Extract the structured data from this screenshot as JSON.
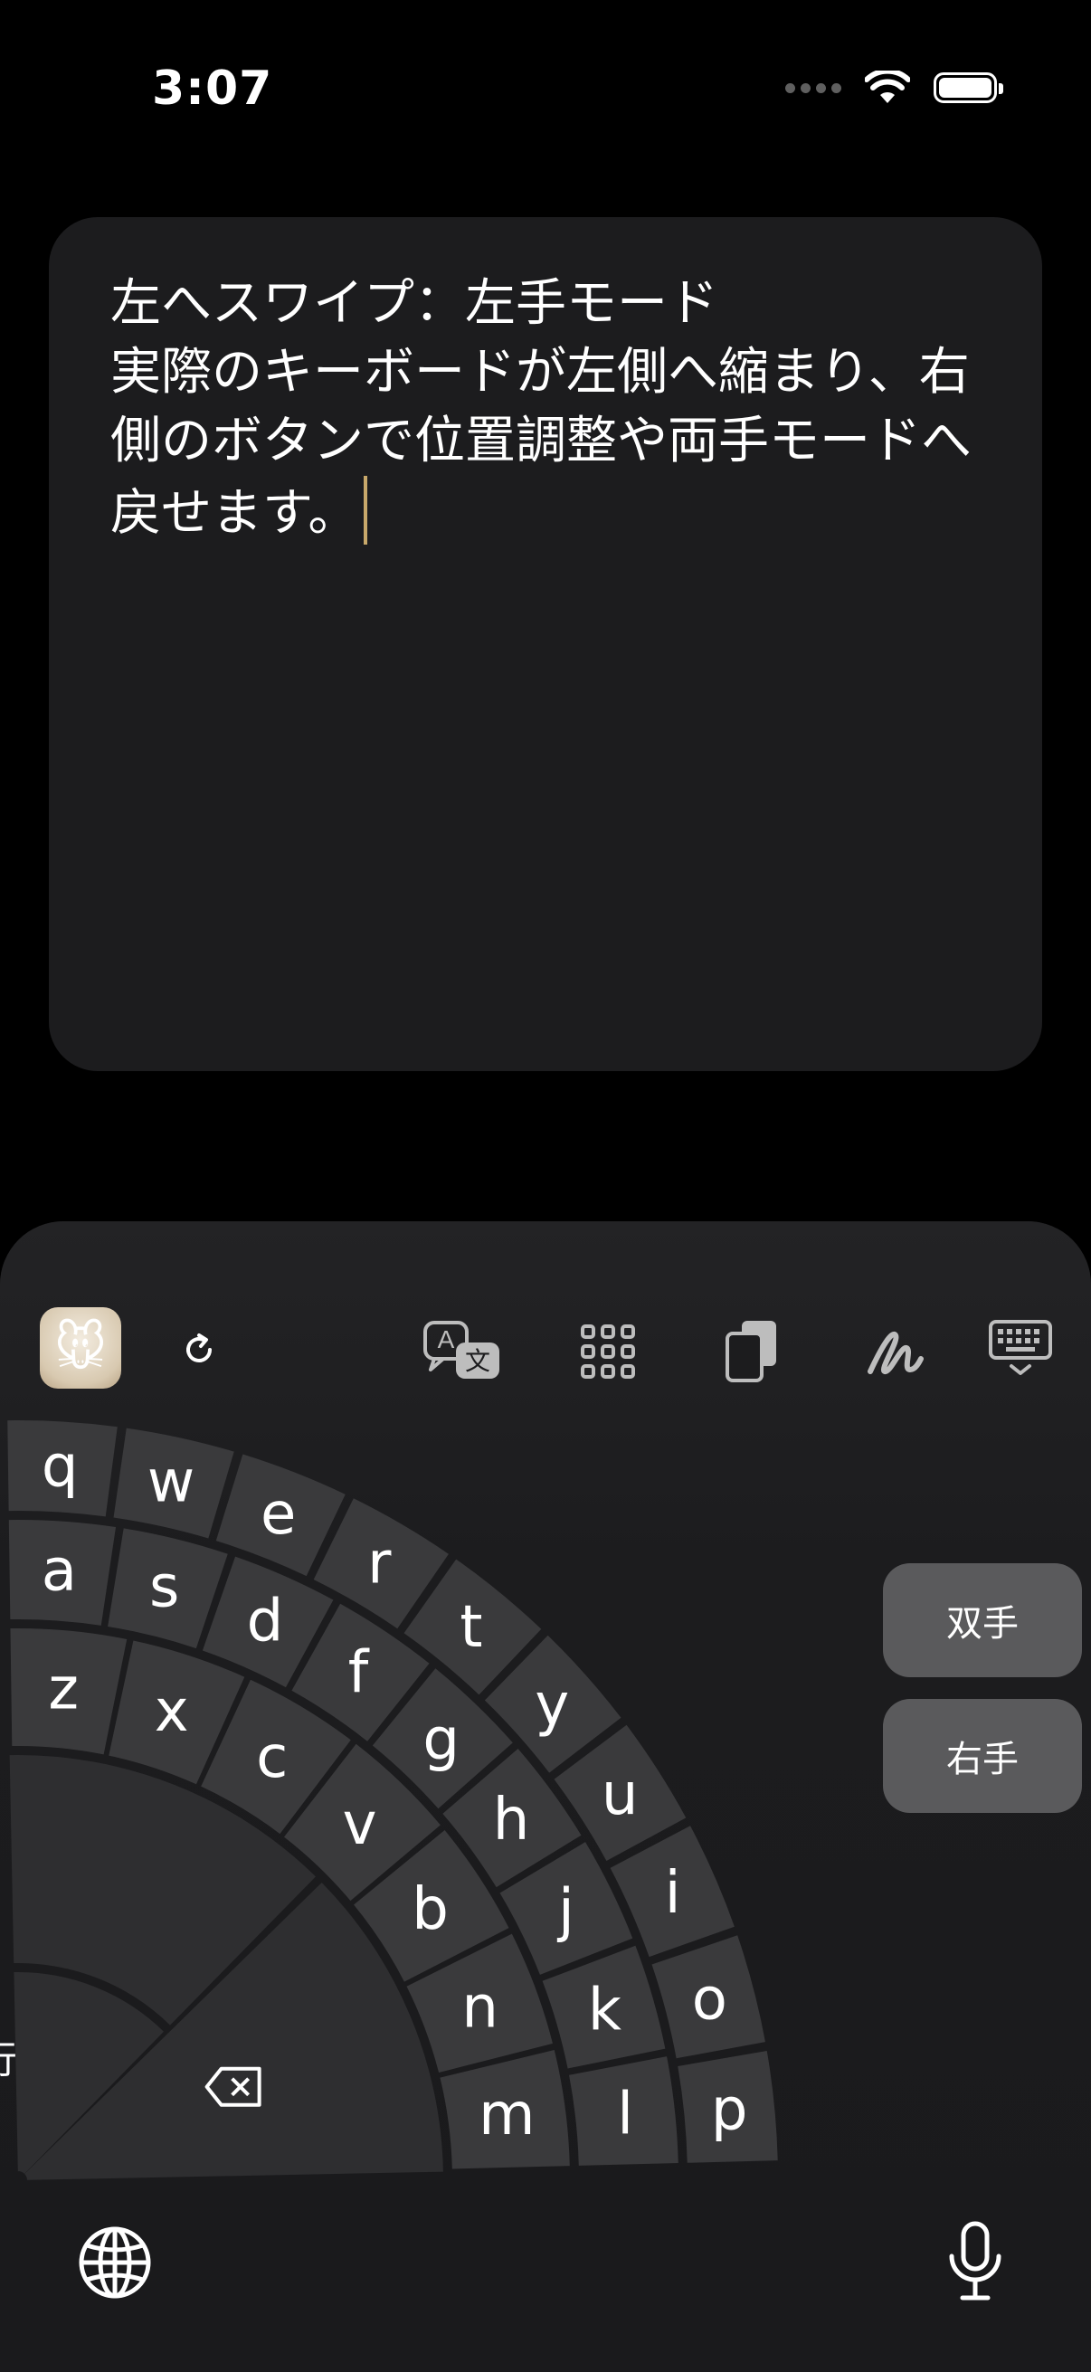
{
  "status_bar": {
    "time": "3:07"
  },
  "note": {
    "text": "左へスワイプ：左手モード\n実際のキーボードが左側へ縮まり、右側のボタンで位置調整や両手モードへ戻せます。"
  },
  "keyboard": {
    "side_buttons": {
      "both_hands": "双手",
      "right_hand": "右手"
    },
    "rows": [
      [
        "q",
        "w",
        "e",
        "r",
        "t",
        "y",
        "u",
        "i",
        "o",
        "p"
      ],
      [
        "a",
        "s",
        "d",
        "f",
        "g",
        "h",
        "j",
        "k",
        "l"
      ],
      [
        "z",
        "x",
        "c",
        "v",
        "b",
        "n",
        "m"
      ]
    ],
    "return_label": "換行",
    "key_color": "#3a3a3c",
    "special_key_color": "#2e2e30"
  },
  "toolbar": {
    "icons": [
      "app-icon",
      "refresh-icon",
      "translate-icon",
      "grid-icon",
      "clipboard-icon",
      "handwriting-icon",
      "keyboard-hide-icon"
    ]
  },
  "bottom_bar": {
    "icons": [
      "globe-icon",
      "microphone-icon"
    ]
  }
}
